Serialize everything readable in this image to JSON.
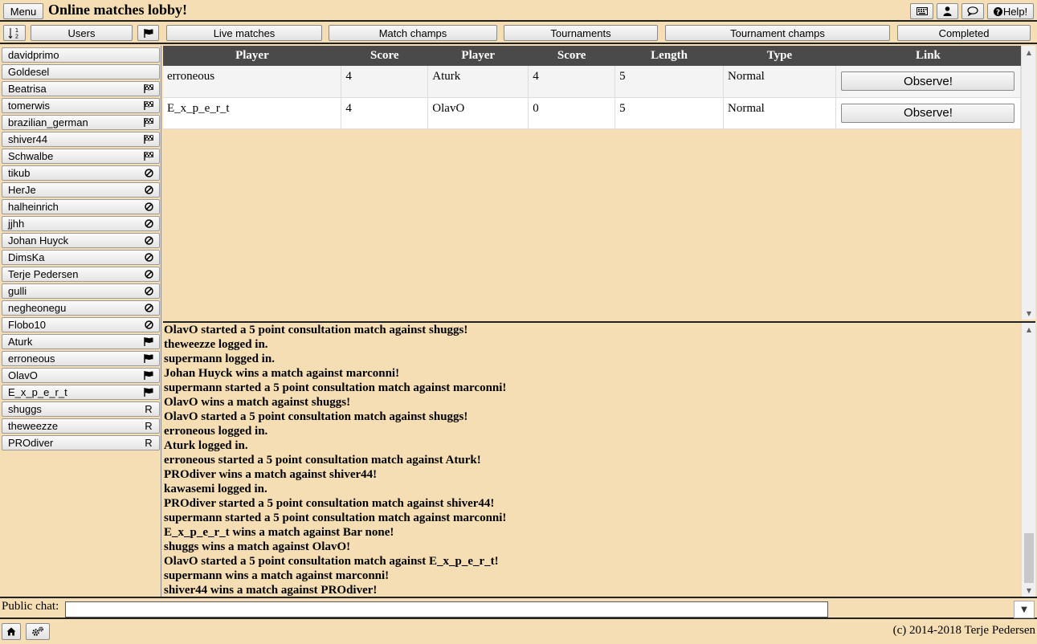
{
  "header": {
    "menu_label": "Menu",
    "title": "Online matches lobby!",
    "help_label": "Help!",
    "icons": [
      "keyboard-icon",
      "user-icon",
      "chat-bubble-icon",
      "help-circle-icon"
    ]
  },
  "tabs": {
    "sort_icon": "sort-numeric-icon",
    "users_label": "Users",
    "flag_icon": "flag-icon",
    "live": "Live matches",
    "match_champs": "Match champs",
    "tournaments": "Tournaments",
    "tournament_champs": "Tournament champs",
    "completed": "Completed"
  },
  "users": [
    {
      "name": "davidprimo",
      "status": ""
    },
    {
      "name": "Goldesel",
      "status": ""
    },
    {
      "name": "Beatrisa",
      "status": "checkered-flag"
    },
    {
      "name": "tomerwis",
      "status": "checkered-flag"
    },
    {
      "name": "brazilian_german",
      "status": "checkered-flag"
    },
    {
      "name": "shiver44",
      "status": "checkered-flag"
    },
    {
      "name": "Schwalbe",
      "status": "checkered-flag"
    },
    {
      "name": "tikub",
      "status": "blocked"
    },
    {
      "name": "HerJe",
      "status": "blocked"
    },
    {
      "name": "halheinrich",
      "status": "blocked"
    },
    {
      "name": "jjhh",
      "status": "blocked"
    },
    {
      "name": "Johan Huyck",
      "status": "blocked"
    },
    {
      "name": "DimsKa",
      "status": "blocked"
    },
    {
      "name": "Terje Pedersen",
      "status": "blocked"
    },
    {
      "name": "gulli",
      "status": "blocked"
    },
    {
      "name": "negheonegu",
      "status": "blocked"
    },
    {
      "name": "Flobo10",
      "status": "blocked"
    },
    {
      "name": "Aturk",
      "status": "flag"
    },
    {
      "name": "erroneous",
      "status": "flag"
    },
    {
      "name": "OlavO",
      "status": "flag"
    },
    {
      "name": "E_x_p_e_r_t",
      "status": "flag"
    },
    {
      "name": "shuggs",
      "status": "R"
    },
    {
      "name": "theweezze",
      "status": "R"
    },
    {
      "name": "PROdiver",
      "status": "R"
    }
  ],
  "matches": {
    "columns": [
      "Player",
      "Score",
      "Player",
      "Score",
      "Length",
      "Type",
      "Link"
    ],
    "rows": [
      {
        "p1": "erroneous",
        "s1": "4",
        "p2": "Aturk",
        "s2": "4",
        "length": "5",
        "type": "Normal",
        "link": "Observe!"
      },
      {
        "p1": "E_x_p_e_r_t",
        "s1": "4",
        "p2": "OlavO",
        "s2": "0",
        "length": "5",
        "type": "Normal",
        "link": "Observe!"
      }
    ]
  },
  "log": [
    "OlavO started a 5 point consultation match against shuggs!",
    "theweezze logged in.",
    "supermann logged in.",
    "Johan Huyck wins a match against marconni!",
    "supermann started a 5 point consultation match against marconni!",
    "OlavO wins a match against shuggs!",
    "OlavO started a 5 point consultation match against shuggs!",
    "erroneous logged in.",
    "Aturk logged in.",
    "erroneous started a 5 point consultation match against Aturk!",
    "PROdiver wins a match against shiver44!",
    "kawasemi logged in.",
    "PROdiver started a 5 point consultation match against shiver44!",
    "supermann started a 5 point consultation match against marconni!",
    "E_x_p_e_r_t wins a match against Bar none!",
    "shuggs wins a match against OlavO!",
    "OlavO started a 5 point consultation match against E_x_p_e_r_t!",
    "supermann wins a match against marconni!",
    "shiver44 wins a match against PROdiver!"
  ],
  "chat": {
    "label": "Public chat:",
    "value": ""
  },
  "footer": {
    "copyright": "(c) 2014-2018 Terje Pedersen"
  }
}
